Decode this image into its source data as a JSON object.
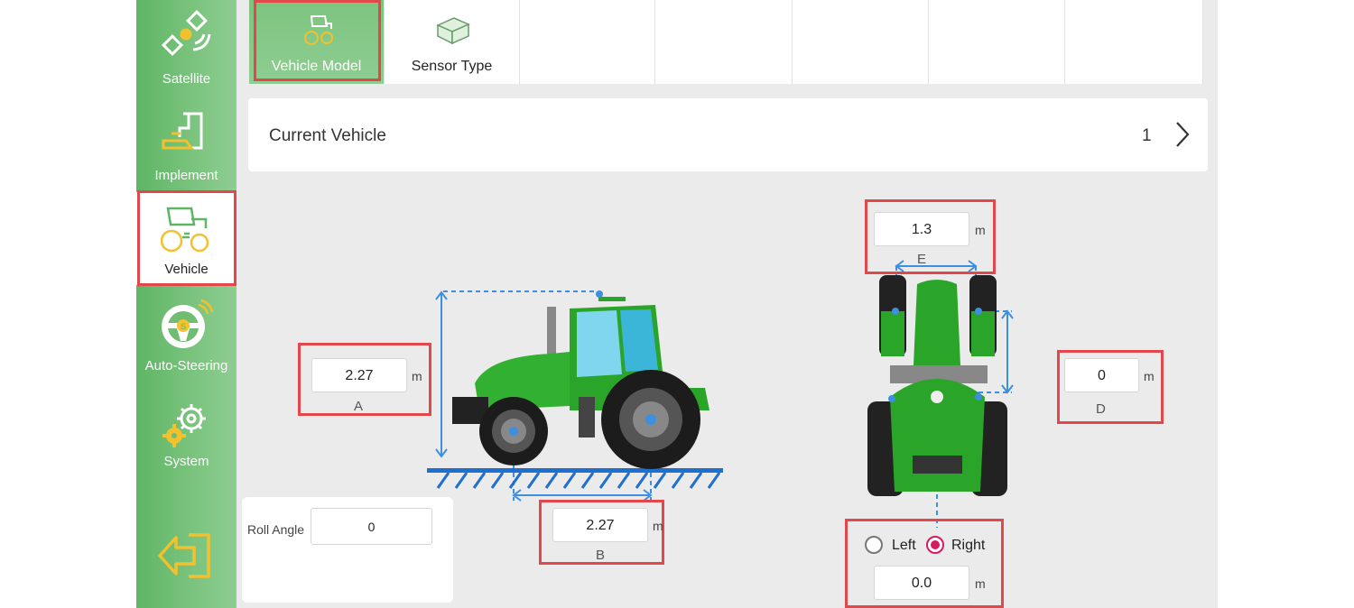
{
  "sidebar": {
    "items": [
      {
        "label": "Satellite",
        "icon": "satellite-icon"
      },
      {
        "label": "Implement",
        "icon": "implement-icon"
      },
      {
        "label": "Vehicle",
        "icon": "tractor-icon",
        "active": true
      },
      {
        "label": "Auto-Steering",
        "icon": "steering-wheel-icon"
      },
      {
        "label": "System",
        "icon": "gear-icon"
      }
    ],
    "exit_icon": "exit-icon"
  },
  "tabs": [
    {
      "label": "Vehicle Model",
      "icon": "tractor-icon",
      "active": true
    },
    {
      "label": "Sensor Type",
      "icon": "sensor-box-icon"
    }
  ],
  "current_vehicle": {
    "label": "Current Vehicle",
    "value": "1"
  },
  "dimensions": {
    "A": {
      "value": "2.27",
      "unit": "m",
      "letter": "A"
    },
    "B": {
      "value": "2.27",
      "unit": "m",
      "letter": "B"
    },
    "D": {
      "value": "0",
      "unit": "m",
      "letter": "D"
    },
    "E": {
      "value": "1.3",
      "unit": "m",
      "letter": "E"
    }
  },
  "roll": {
    "label": "Roll Angle",
    "value": "0"
  },
  "offset": {
    "left_label": "Left",
    "right_label": "Right",
    "selected": "Right",
    "value": "0.0",
    "unit": "m"
  },
  "colors": {
    "accent_green": "#7cc47f",
    "highlight_red": "#e2474b",
    "radio_pink": "#d81b60",
    "dimension_blue": "#3d8fe0"
  }
}
